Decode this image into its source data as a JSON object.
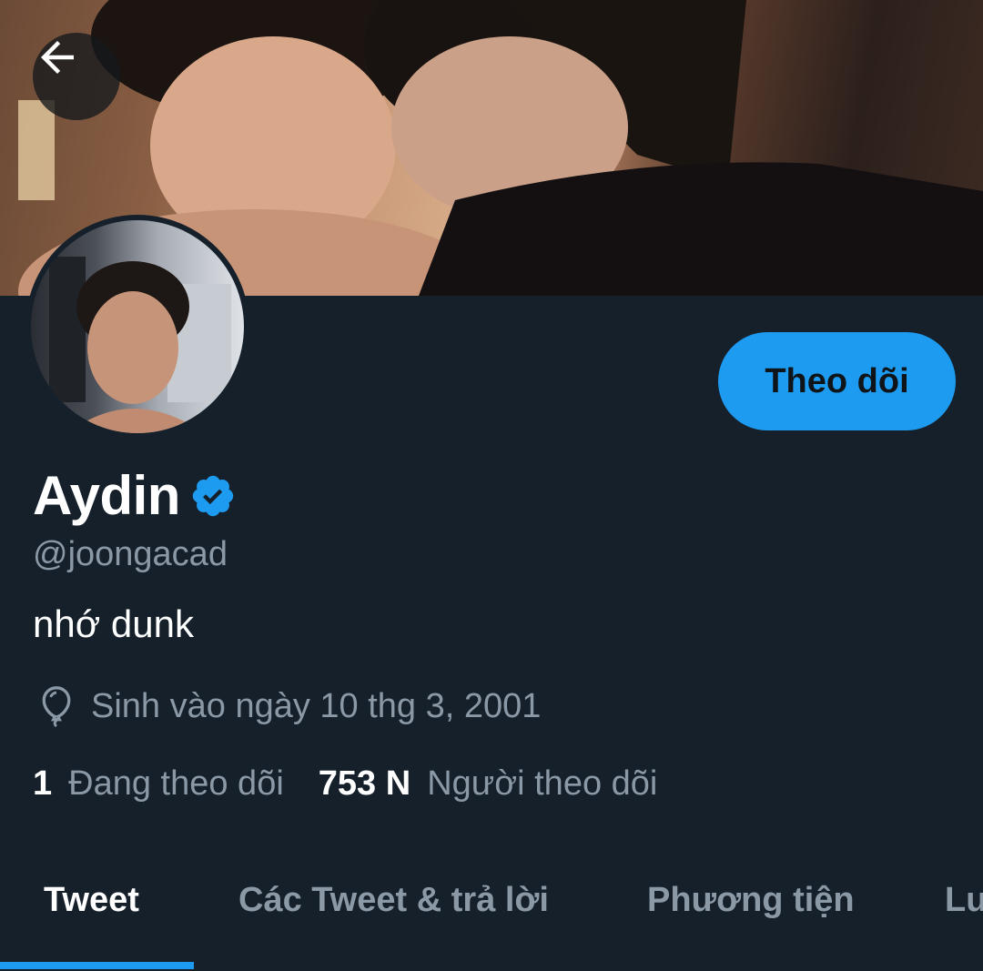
{
  "header": {
    "back_icon": "arrow-left-icon"
  },
  "profile": {
    "display_name": "Aydin",
    "verified_icon": "verified-badge-icon",
    "handle": "@joongacad",
    "bio": "nhớ dunk",
    "birth_icon": "balloon-icon",
    "birth_text": "Sinh vào ngày 10 thg 3, 2001",
    "follow_label": "Theo dõi",
    "following_count": "1",
    "following_label": "Đang theo dõi",
    "followers_count": "753 N",
    "followers_label": "Người theo dõi"
  },
  "tabs": [
    {
      "label": "Tweet",
      "active": true
    },
    {
      "label": "Các Tweet & trả lời",
      "active": false
    },
    {
      "label": "Phương tiện",
      "active": false
    },
    {
      "label": "Lượt thích",
      "active": false
    }
  ],
  "colors": {
    "background": "#15202b",
    "accent": "#1d9bf0",
    "secondary_text": "#8b98a5",
    "primary_text": "#ffffff"
  }
}
